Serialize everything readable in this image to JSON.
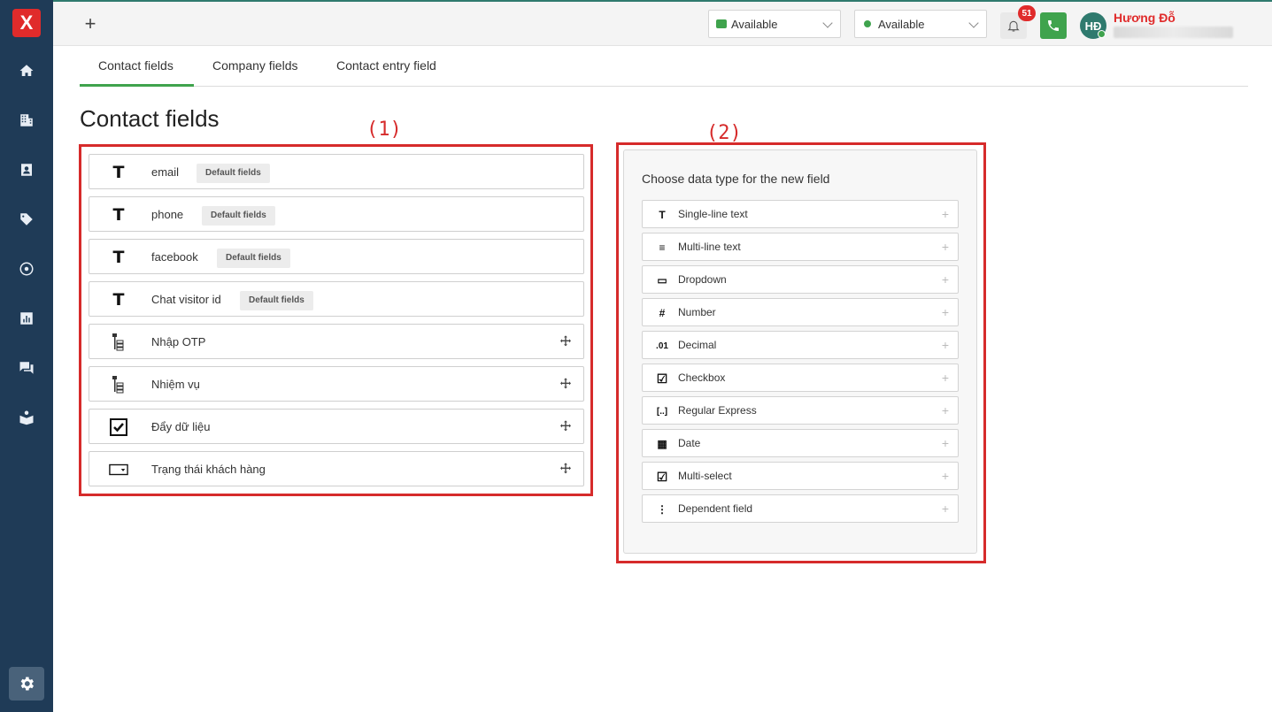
{
  "app": {
    "logo_text": "X"
  },
  "topbar": {
    "chat_status": "Available",
    "call_status": "Available",
    "notifications_count": "51",
    "user_initials": "HĐ",
    "user_name": "Hương Đỗ",
    "accent_green": "#3fa34d",
    "accent_red": "#e02b2b"
  },
  "tabs": [
    {
      "label": "Contact fields"
    },
    {
      "label": "Company fields"
    },
    {
      "label": "Contact entry field"
    }
  ],
  "page_title": "Contact fields",
  "annotations": {
    "box1": "(1)",
    "box2": "(2)"
  },
  "fields": [
    {
      "label": "email",
      "icon": "text-icon",
      "tag": "Default fields"
    },
    {
      "label": "phone",
      "icon": "text-icon",
      "tag": "Default fields"
    },
    {
      "label": "facebook",
      "icon": "text-icon",
      "tag": "Default fields"
    },
    {
      "label": "Chat visitor id",
      "icon": "text-icon",
      "tag": "Default fields"
    },
    {
      "label": "Nhập OTP",
      "icon": "dependent-field-icon"
    },
    {
      "label": "Nhiệm vụ",
      "icon": "dependent-field-icon"
    },
    {
      "label": "Đẩy dữ liệu",
      "icon": "checkbox-icon"
    },
    {
      "label": "Trạng thái khách hàng",
      "icon": "dropdown-icon"
    }
  ],
  "data_types_panel": {
    "title": "Choose data type for the new field",
    "types": [
      {
        "label": "Single-line text",
        "icon_text": "T"
      },
      {
        "label": "Multi-line text",
        "icon_text": "≡"
      },
      {
        "label": "Dropdown",
        "icon_text": "▭"
      },
      {
        "label": "Number",
        "icon_text": "#"
      },
      {
        "label": "Decimal",
        "icon_text": ".01"
      },
      {
        "label": "Checkbox",
        "icon_text": "☑"
      },
      {
        "label": "Regular Express",
        "icon_text": "[..]"
      },
      {
        "label": "Date",
        "icon_text": "▦"
      },
      {
        "label": "Multi-select",
        "icon_text": "☑"
      },
      {
        "label": "Dependent field",
        "icon_text": "⋮"
      }
    ]
  }
}
